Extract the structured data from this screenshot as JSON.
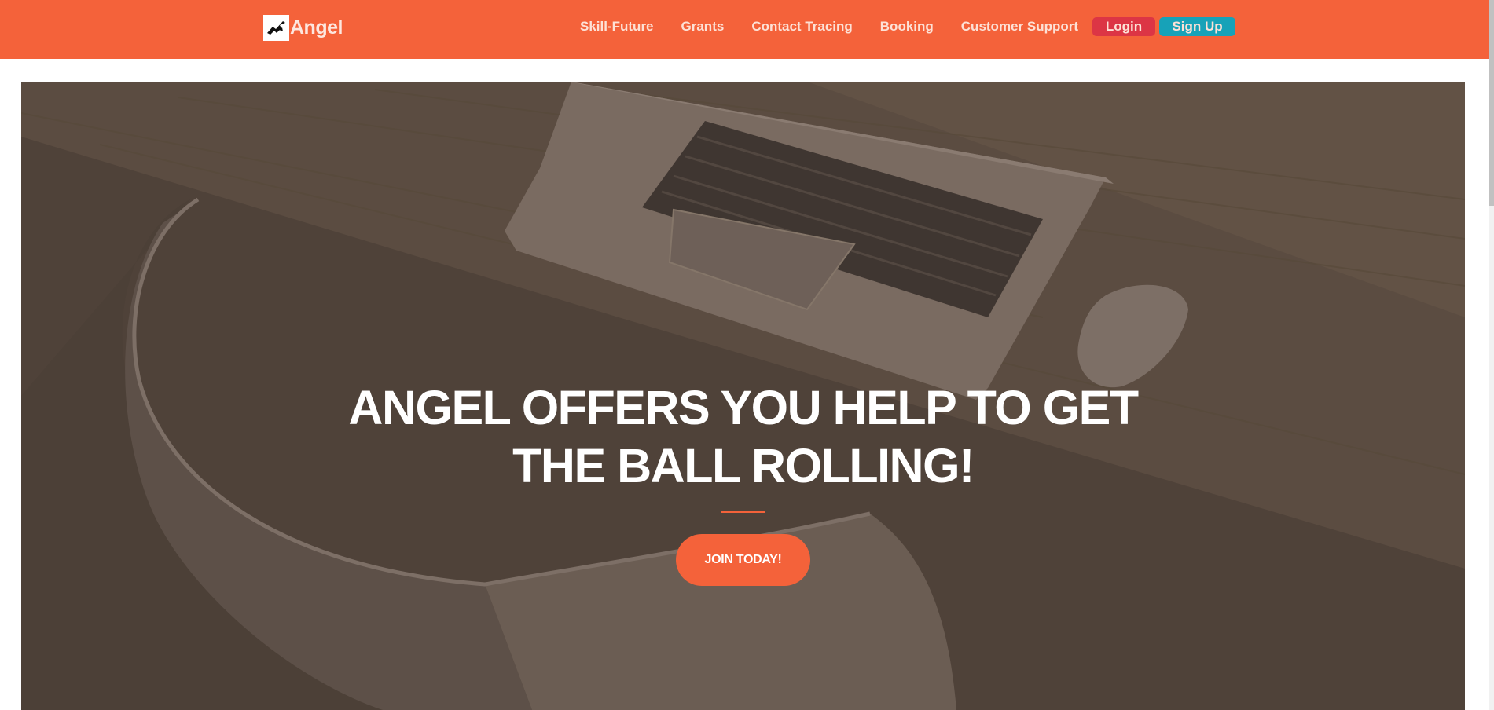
{
  "nav": {
    "brand": "Angel",
    "links": [
      "Skill-Future",
      "Grants",
      "Contact Tracing",
      "Booking",
      "Customer Support"
    ],
    "login_label": "Login",
    "signup_label": "Sign Up"
  },
  "hero": {
    "heading_line1": "ANGEL OFFERS YOU HELP TO GET",
    "heading_line2": "THE BALL ROLLING!",
    "cta_label": "JOIN TODAY!"
  },
  "colors": {
    "primary": "#f4623a",
    "login": "#dc3545",
    "signup": "#17a2b8",
    "hero_overlay": "#4f4239"
  },
  "icons": {
    "brand_logo": "angel-logo-icon"
  }
}
